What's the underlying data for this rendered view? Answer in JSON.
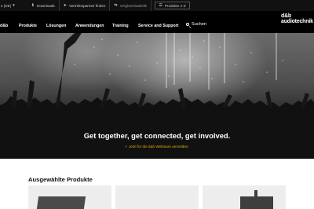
{
  "utility": {
    "language": "e (DE)",
    "downloads": "Downloads",
    "find_partner": "Vertriebspartner finden",
    "compare": "Vergleichstabelle",
    "products_az": "Produkte A-Z"
  },
  "nav": {
    "home": "d&b",
    "items": [
      "Produkte",
      "Lösungen",
      "Anwendungen",
      "Training",
      "Service and Support"
    ],
    "search": "Suchen"
  },
  "logo": {
    "line1": "d&b",
    "line2": "audiotechnik"
  },
  "hero": {
    "title": "Get together, get connected, get involved.",
    "cta": "Jetzt für die d&b Webinare anmelden."
  },
  "products": {
    "title": "Ausgewählte Produkte"
  },
  "colors": {
    "accent": "#e0b000",
    "nav_bg": "#000000",
    "card_bg": "#ededed"
  },
  "icons": [
    "download-icon",
    "location-icon",
    "compare-icon",
    "list-icon",
    "search-icon",
    "arrow-right-icon"
  ]
}
